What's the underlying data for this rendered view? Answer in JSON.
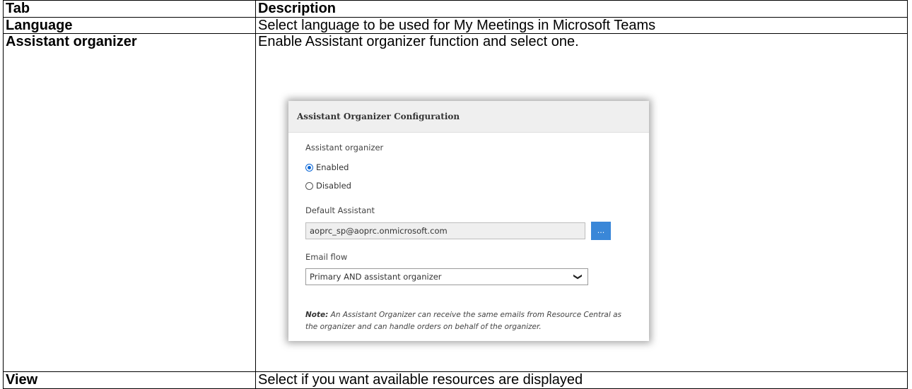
{
  "table": {
    "header": {
      "tab": "Tab",
      "description": "Description"
    },
    "rows": [
      {
        "tab": "Language",
        "description": "Select language to be used for My Meetings in Microsoft Teams"
      },
      {
        "tab": "Assistant organizer",
        "description": "Enable Assistant organizer function and select one."
      },
      {
        "tab": "View",
        "description": "Select if you want available resources are displayed"
      }
    ]
  },
  "dialog": {
    "title": "Assistant Organizer Configuration",
    "assistant_label": "Assistant organizer",
    "options": [
      {
        "label": "Enabled",
        "checked": true
      },
      {
        "label": "Disabled",
        "checked": false
      }
    ],
    "default_assistant_label": "Default Assistant",
    "default_assistant_value": "aoprc_sp@aoprc.onmicrosoft.com",
    "browse_label": "...",
    "email_flow_label": "Email flow",
    "email_flow_value": "Primary AND assistant organizer",
    "note_prefix": "Note:",
    "note_text": " An Assistant Organizer can receive the same emails from Resource Central as the organizer and can handle orders on behalf of the organizer."
  },
  "colors": {
    "accent": "#3a87d8",
    "radio": "#0a66d6",
    "header_bg": "#efefef"
  }
}
